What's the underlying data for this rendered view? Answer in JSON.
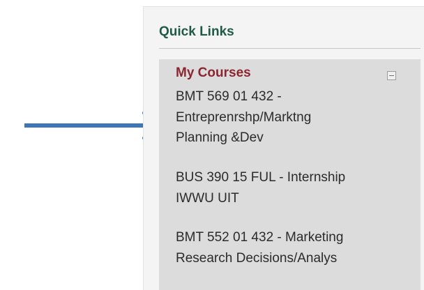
{
  "quick_links": {
    "title": "Quick Links",
    "my_courses": {
      "header": "My Courses",
      "collapse_icon": "collapse-minus-icon",
      "courses": [
        {
          "label": "BMT 569 01 432 - Entreprenrshp/Marktng Planning &Dev",
          "lines": [
            "BMT 569 01 432 -",
            "Entreprenrshp/Marktng",
            "Planning &Dev"
          ]
        },
        {
          "label": "BUS 390 15 FUL - Internship IWWU UIT",
          "lines": [
            "BUS 390 15 FUL - Internship",
            "IWWU UIT"
          ]
        },
        {
          "label": "BMT 552 01 432 - Marketing Research Decisions/Analys",
          "lines": [
            "BMT 552 01 432 - Marketing",
            "Research Decisions/Analys"
          ]
        }
      ]
    }
  },
  "annotation": {
    "icon": "pointer-arrow-icon",
    "color": "#3d76b7"
  },
  "colors": {
    "title": "#1e5a44",
    "courses_header": "#8b2631",
    "panel_background": "#f4f4f4",
    "courses_background": "#dcdcdc",
    "course_text": "#2b2b2b"
  }
}
